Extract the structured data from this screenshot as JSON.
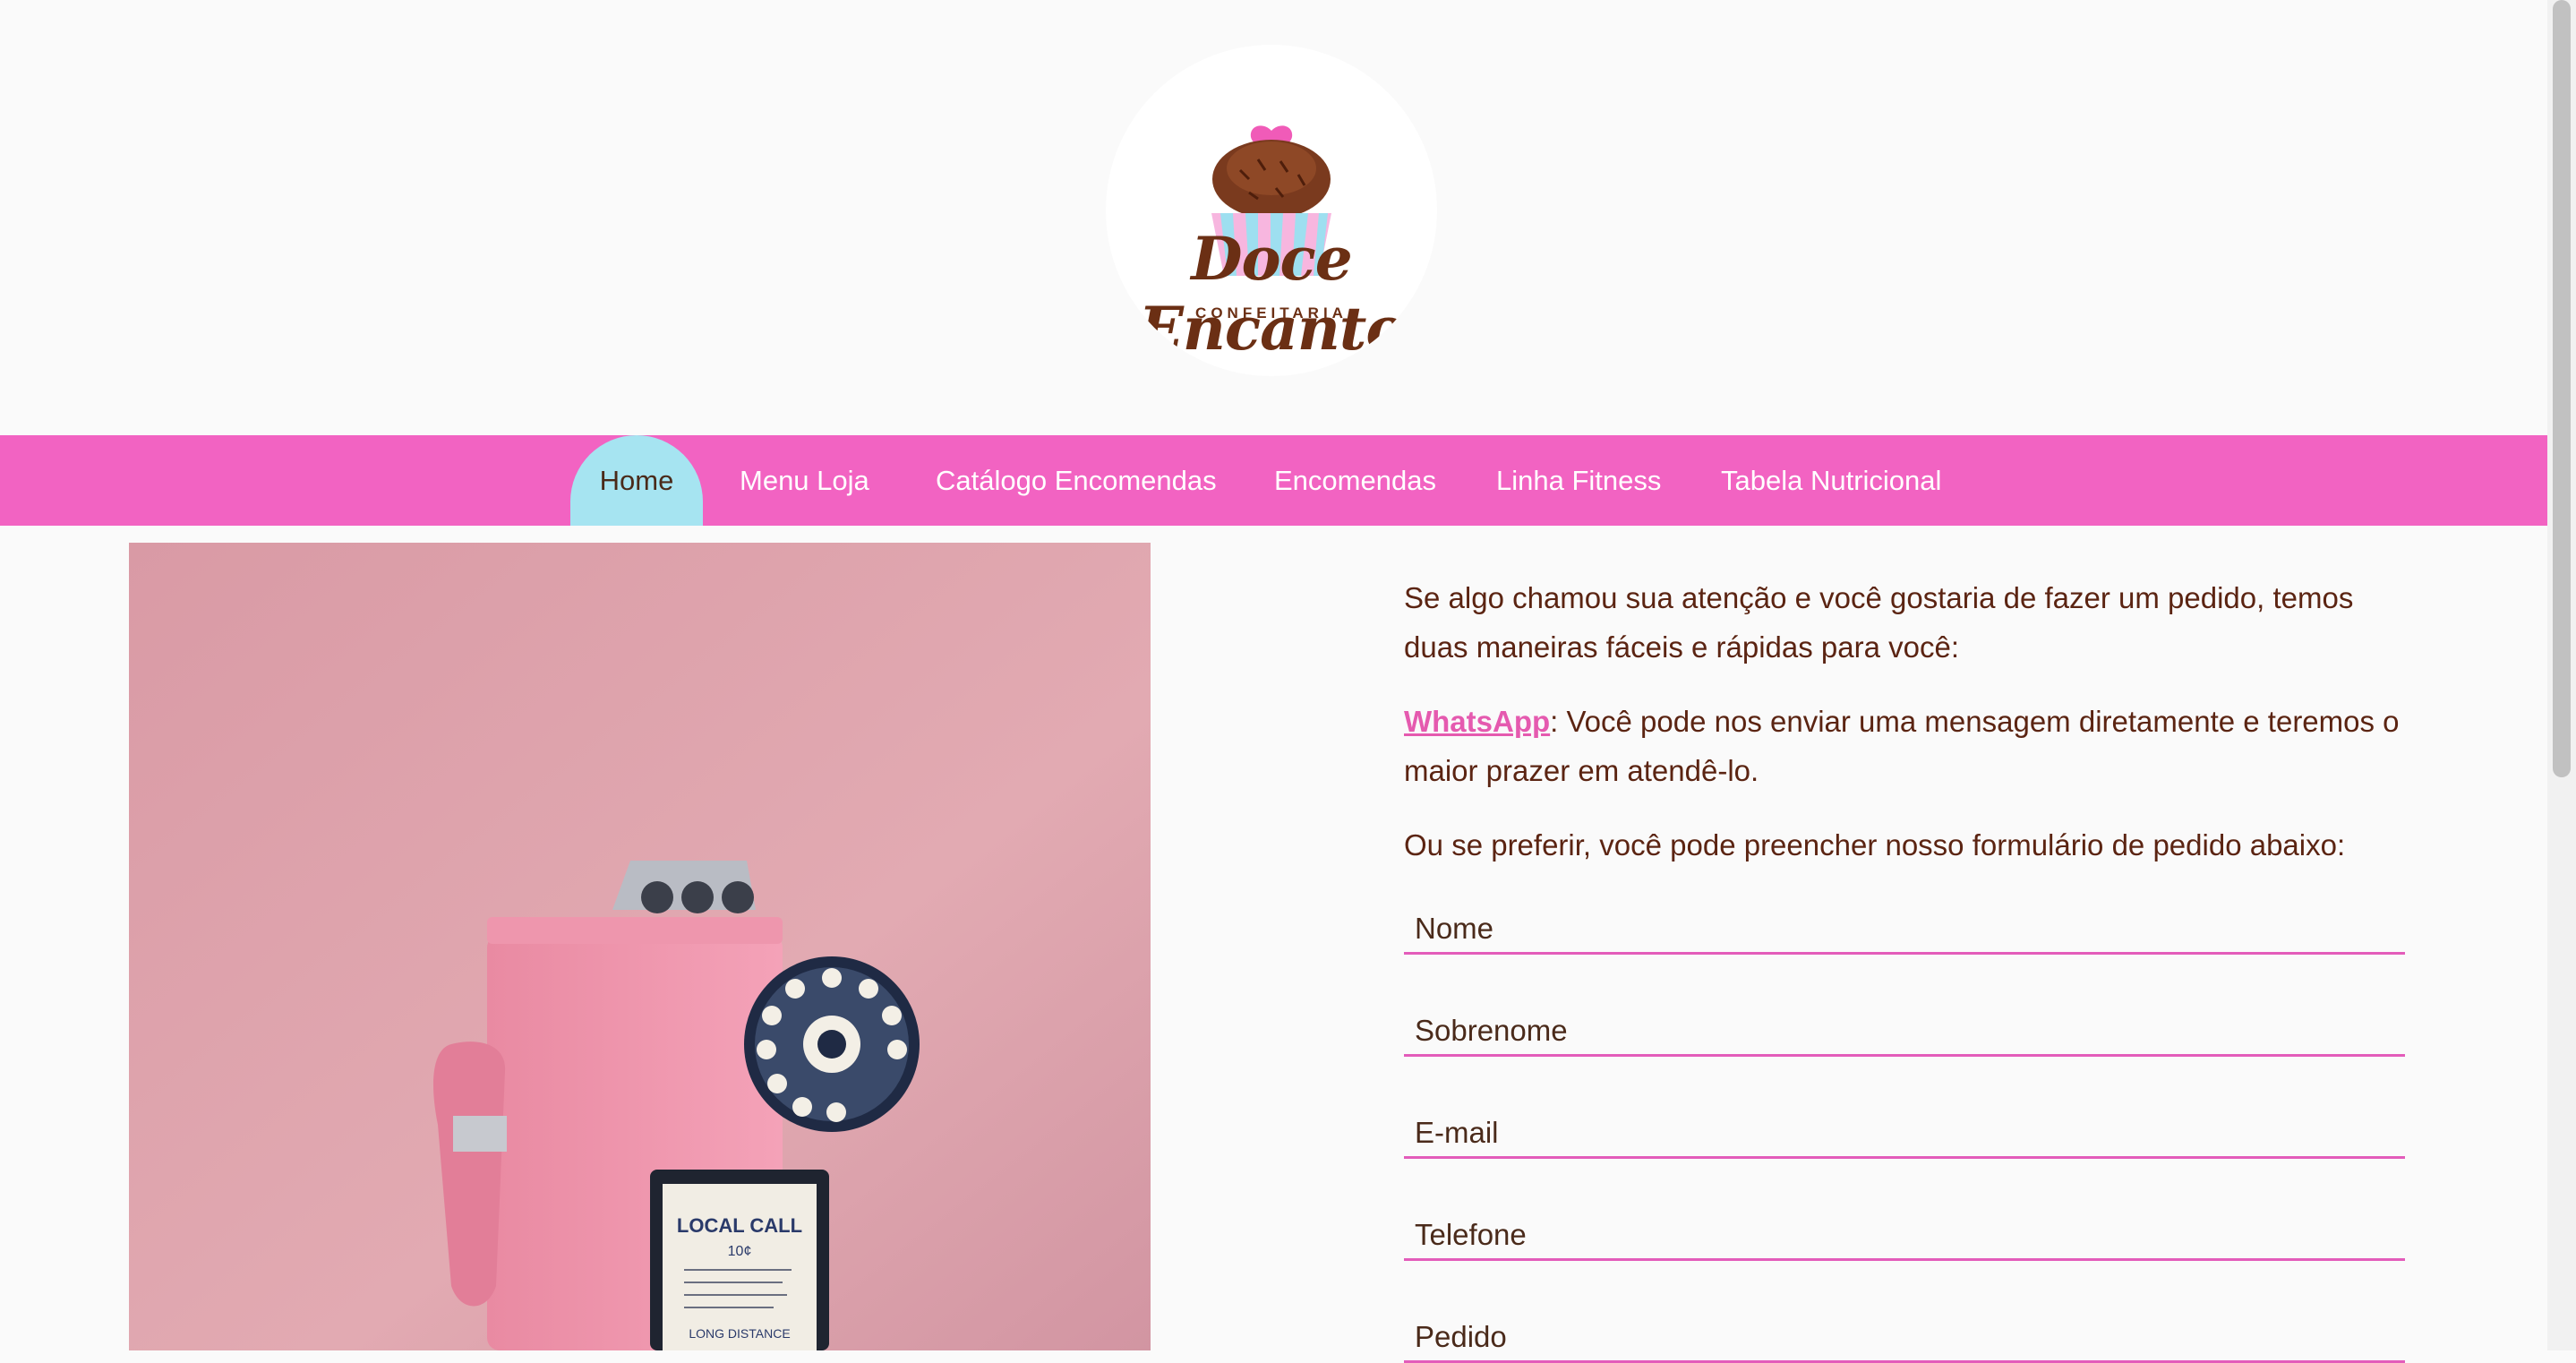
{
  "brand": {
    "name": "Doce Encanto",
    "tagline": "CONFEITARIA",
    "colors": {
      "pink": "#f263c2",
      "brown": "#6b2f14",
      "blue": "#a6e4f1"
    }
  },
  "nav": {
    "items": [
      {
        "label": "Home",
        "active": true
      },
      {
        "label": "Menu Loja"
      },
      {
        "label": "Catálogo Encomendas"
      },
      {
        "label": "Encomendas"
      },
      {
        "label": "Linha Fitness"
      },
      {
        "label": "Tabela Nutricional"
      }
    ]
  },
  "content": {
    "intro": "Se algo chamou sua atenção e você gostaria de fazer um pedido, temos duas maneiras fáceis e rápidas para você:",
    "whatsapp_link": "WhatsApp",
    "whatsapp_text": ": Você pode nos enviar uma mensagem diretamente e teremos o maior prazer em atendê-lo.",
    "form_intro": "Ou se preferir, você pode preencher nosso formulário de pedido abaixo:"
  },
  "form": {
    "fields": [
      {
        "placeholder": "Nome"
      },
      {
        "placeholder": "Sobrenome"
      },
      {
        "placeholder": "E-mail"
      },
      {
        "placeholder": "Telefone"
      },
      {
        "placeholder": "Pedido"
      }
    ]
  },
  "hero": {
    "icon": "pink-payphone-image",
    "sign_title": "LOCAL CALL",
    "sign_price": "10¢",
    "sign_footer": "LONG DISTANCE"
  }
}
